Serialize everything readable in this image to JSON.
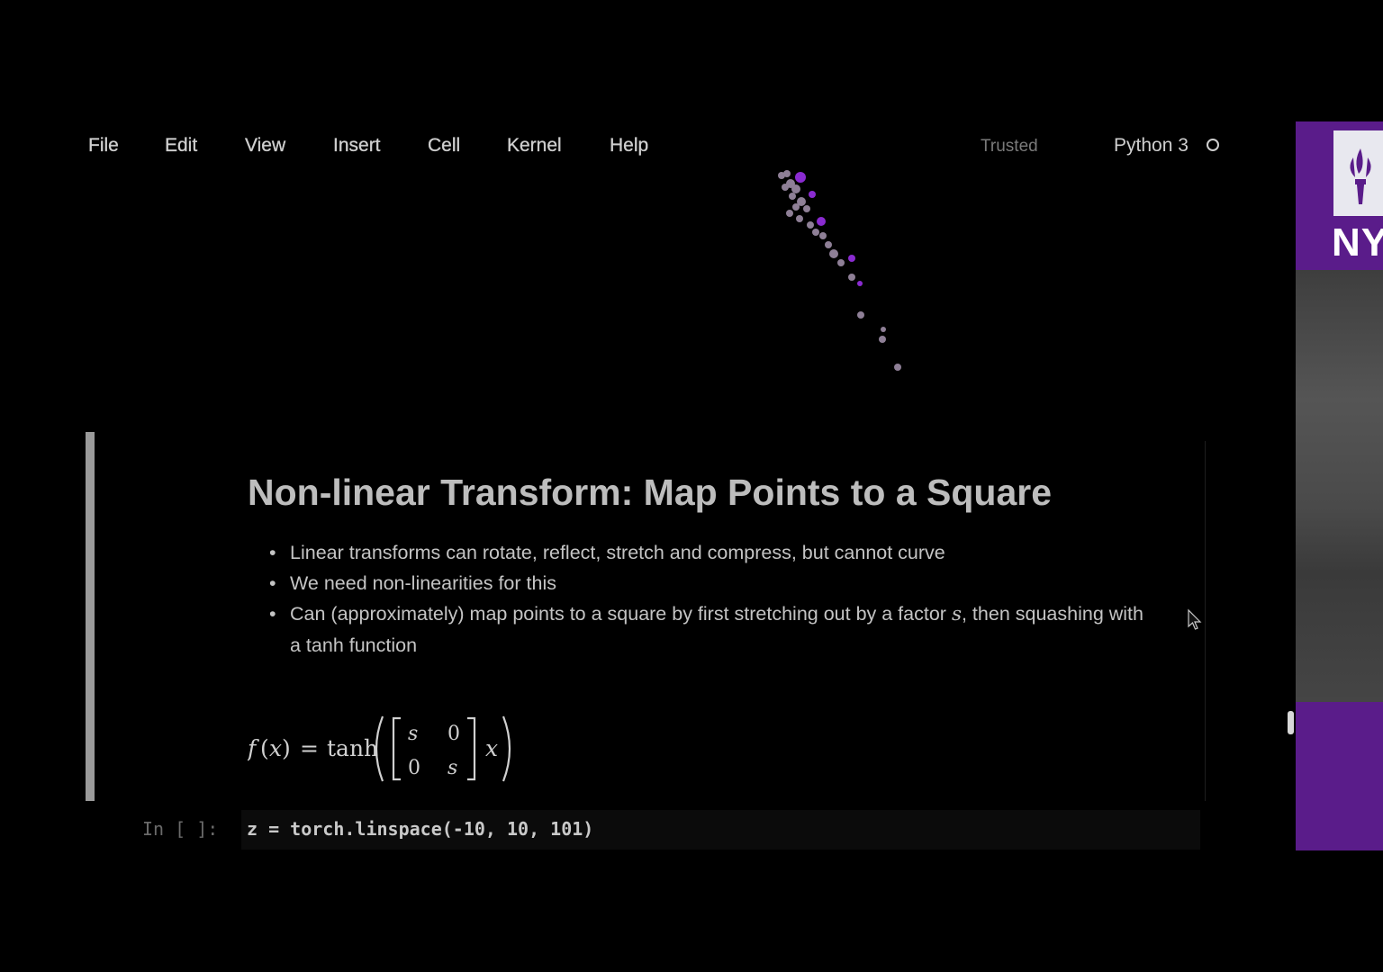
{
  "menu": {
    "items": [
      {
        "label": "File"
      },
      {
        "label": "Edit"
      },
      {
        "label": "View"
      },
      {
        "label": "Insert"
      },
      {
        "label": "Cell"
      },
      {
        "label": "Kernel"
      },
      {
        "label": "Help"
      }
    ]
  },
  "status": {
    "trusted": "Trusted",
    "kernel": "Python 3"
  },
  "markdown_cell": {
    "title": "Non-linear Transform: Map Points to a Square",
    "bullets": [
      "Linear transforms can rotate, reflect, stretch and compress, but cannot curve",
      "We need non-linearities for this"
    ],
    "bullet3_before": "Can (approximately) map points to a square by first stretching out by a factor ",
    "bullet3_var": "s",
    "bullet3_after": ", then squashing with a tanh function",
    "equation": "f(x) = tanh([s 0; 0 s] x)"
  },
  "code_cell": {
    "prompt": "In [ ]:",
    "code": "z = torch.linspace(-10, 10, 101)"
  },
  "side_panel": {
    "logo_text": "NY"
  },
  "colors": {
    "purple": "#5a1c8a",
    "point_purple": "#8a2bd0",
    "point_gray": "#8e7f96"
  }
}
